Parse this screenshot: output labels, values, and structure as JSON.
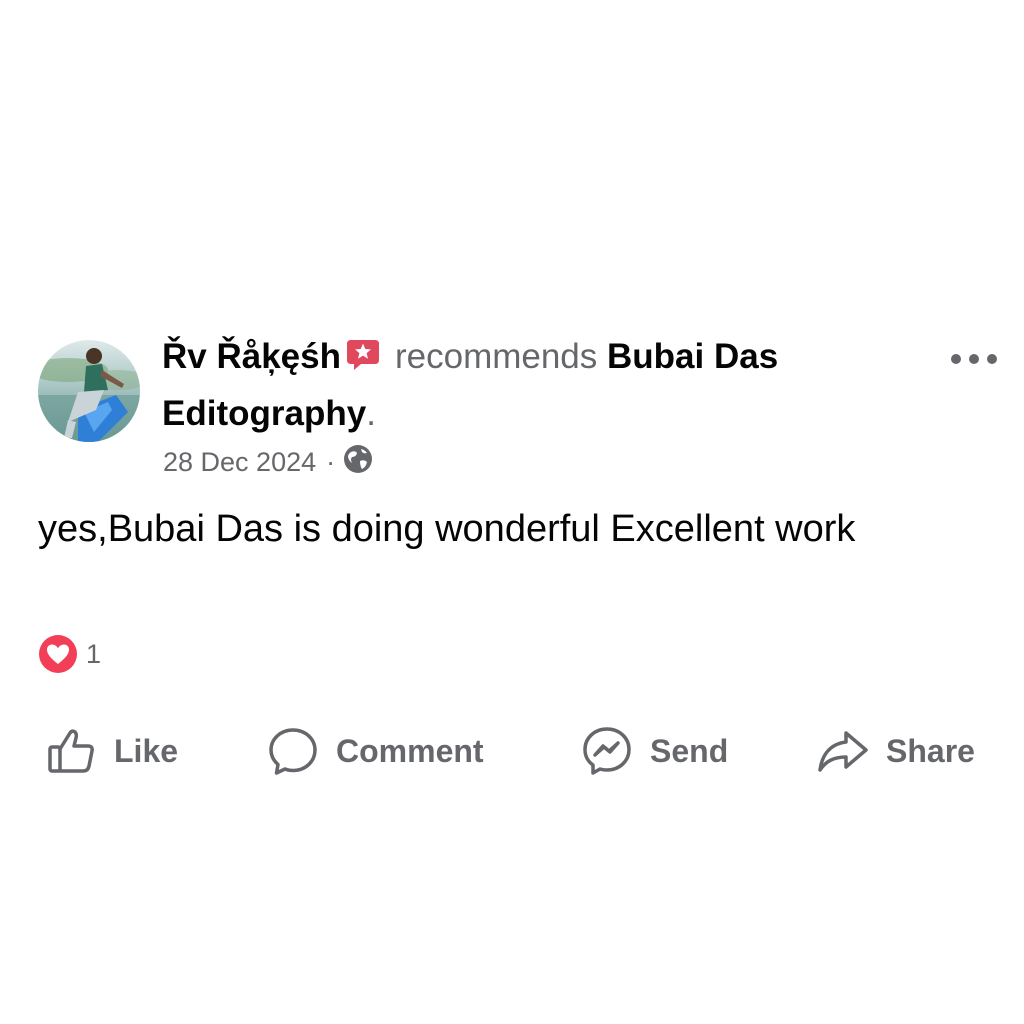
{
  "post": {
    "author": "Řv  Řåķęśh",
    "verb": "recommends",
    "page": "Bubai Das Editography",
    "period": ".",
    "date": "28 Dec 2024",
    "separator": "·",
    "text": "yes,Bubai Das is doing wonderful Excellent work",
    "reaction_count": "1",
    "icons": {
      "badge": "review-star-badge-icon",
      "privacy": "globe-icon",
      "reaction": "heart-reaction-icon",
      "more": "more-dots-icon"
    }
  },
  "actions": [
    {
      "label": "Like",
      "icon": "thumbs-up-icon"
    },
    {
      "label": "Comment",
      "icon": "comment-bubble-icon"
    },
    {
      "label": "Send",
      "icon": "messenger-icon"
    },
    {
      "label": "Share",
      "icon": "share-arrow-icon"
    }
  ],
  "colors": {
    "text_primary": "#050505",
    "text_secondary": "#65676b",
    "reaction_red": "#f33e58",
    "badge_red": "#e0485e"
  }
}
